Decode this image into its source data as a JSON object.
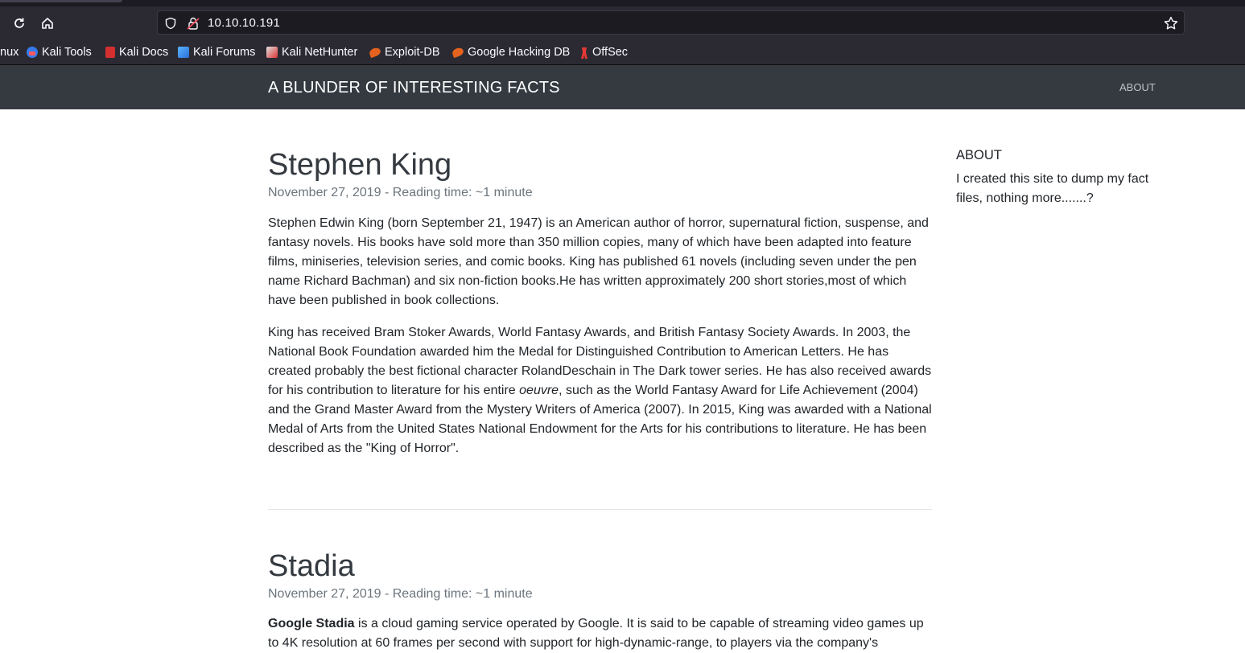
{
  "browser": {
    "url": "10.10.10.191",
    "bookmarks": [
      {
        "label": "nux",
        "icon": "linux-icon"
      },
      {
        "label": "Kali Tools",
        "icon": "kali-tools-icon"
      },
      {
        "label": "Kali Docs",
        "icon": "kali-docs-icon"
      },
      {
        "label": "Kali Forums",
        "icon": "kali-forums-icon"
      },
      {
        "label": "Kali NetHunter",
        "icon": "kali-nethunter-icon"
      },
      {
        "label": "Exploit-DB",
        "icon": "exploit-db-icon"
      },
      {
        "label": "Google Hacking DB",
        "icon": "ghdb-icon"
      },
      {
        "label": "OffSec",
        "icon": "offsec-icon"
      }
    ]
  },
  "site": {
    "brand": "A BLUNDER OF INTERESTING FACTS",
    "nav_about": "ABOUT"
  },
  "posts": [
    {
      "title": "Stephen King",
      "meta": "November 27, 2019 - Reading time: ~1 minute",
      "p1": "Stephen Edwin King (born September 21, 1947) is an American author of horror, supernatural fiction, suspense, and fantasy novels. His books have sold more than 350 million copies, many of which have been adapted into feature films, miniseries, television series, and comic books. King has published 61 novels (including seven under the pen name Richard Bachman) and six non-fiction books.He has written approximately 200 short stories,most of which have been published in book collections.",
      "p2_before": "King has received Bram Stoker Awards, World Fantasy Awards, and British Fantasy Society Awards. In 2003, the National Book Foundation awarded him the Medal for Distinguished Contribution to American Letters. He has created probably the best fictional character RolandDeschain in The Dark tower series. He has also received awards for his contribution to literature for his entire ",
      "p2_em": "oeuvre",
      "p2_after": ", such as the World Fantasy Award for Life Achievement (2004) and the Grand Master Award from the Mystery Writers of America (2007). In 2015, King was awarded with a National Medal of Arts from the United States National Endowment for the Arts for his contributions to literature. He has been described as the \"King of Horror\"."
    },
    {
      "title": "Stadia",
      "meta": "November 27, 2019 - Reading time: ~1 minute",
      "p1_strong": "Google Stadia",
      "p1_rest": " is a cloud gaming service operated by Google. It is said to be capable of streaming video games up to 4K resolution at 60 frames per second with support for high-dynamic-range, to players via the company's"
    }
  ],
  "sidebar": {
    "title": "ABOUT",
    "text": "I created this site to dump my fact files, nothing more.......?"
  },
  "colors": {
    "navbar": "#343a40",
    "browser_toolbar": "#2b2a33",
    "meta_text": "#6c757d"
  }
}
